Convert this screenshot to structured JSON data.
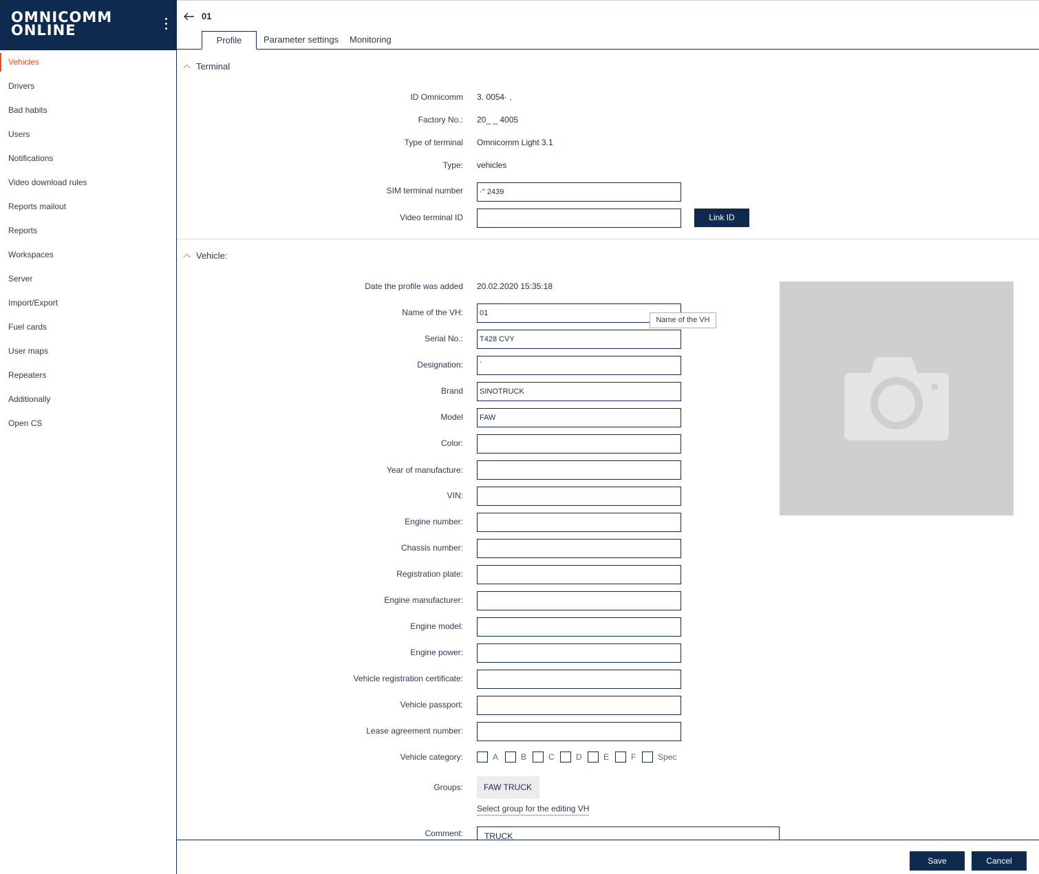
{
  "app": {
    "logo_line1": "OMNICOMM",
    "logo_line2": "ONLINE"
  },
  "sidebar": {
    "items": [
      {
        "label": "Vehicles",
        "active": true
      },
      {
        "label": "Drivers"
      },
      {
        "label": "Bad habits"
      },
      {
        "label": "Users"
      },
      {
        "label": "Notifications"
      },
      {
        "label": "Video download rules"
      },
      {
        "label": "Reports mailout"
      },
      {
        "label": "Reports"
      },
      {
        "label": "Workspaces"
      },
      {
        "label": "Server"
      },
      {
        "label": "Import/Export"
      },
      {
        "label": "Fuel cards"
      },
      {
        "label": "User maps"
      },
      {
        "label": "Repeaters"
      },
      {
        "label": "Additionally"
      },
      {
        "label": "Open CS"
      }
    ]
  },
  "header": {
    "title": "01",
    "tabs": [
      "Profile",
      "Parameter settings",
      "Monitoring"
    ]
  },
  "terminal": {
    "section_title": "Terminal",
    "id_label": "ID Omnicomm",
    "id_value": "3.  0054·  ,",
    "factory_label": "Factory No.:",
    "factory_value": "20_ _ 4005",
    "type_terminal_label": "Type of terminal",
    "type_terminal_value": "Omnicomm Light 3.1",
    "type_label": "Type:",
    "type_value": "vehicles",
    "sim_label": "SIM terminal number",
    "sim_value": "  ·'' 2439",
    "video_label": "Video terminal ID",
    "video_value": "",
    "link_button": "Link ID"
  },
  "vehicle": {
    "section_title": "Vehicle:",
    "date_label": "Date the profile was added",
    "date_value": "20.02.2020 15:35:18",
    "name_tooltip": "Name of the VH",
    "fields": [
      {
        "label": "Name of the VH:",
        "value": "01"
      },
      {
        "label": "Serial No.:",
        "value": "T428 CVY"
      },
      {
        "label": "Designation:",
        "value": "                  `"
      },
      {
        "label": "Brand",
        "value": "SINOTRUCK"
      },
      {
        "label": "Model",
        "value": "FAW"
      },
      {
        "label": "Color:",
        "value": ""
      },
      {
        "label": "Year of manufacture:",
        "value": ""
      },
      {
        "label": "VIN:",
        "value": ""
      },
      {
        "label": "Engine number:",
        "value": ""
      },
      {
        "label": "Chassis number:",
        "value": ""
      },
      {
        "label": "Registration plate:",
        "value": ""
      },
      {
        "label": "Engine manufacturer:",
        "value": ""
      },
      {
        "label": "Engine model:",
        "value": ""
      },
      {
        "label": "Engine power:",
        "value": ""
      },
      {
        "label": "Vehicle registration certificate:",
        "value": ""
      },
      {
        "label": "Vehicle passport:",
        "value": ""
      },
      {
        "label": "Lease agreement number:",
        "value": ""
      }
    ],
    "category_label": "Vehicle category:",
    "categories": [
      "A",
      "B",
      "C",
      "D",
      "E",
      "F",
      "Spec"
    ],
    "groups_label": "Groups:",
    "group_chip": "FAW TRUCK",
    "group_link": "Select group for the editing VH",
    "comment_label": "Comment:",
    "comment_value": "TRUCK"
  },
  "footer": {
    "save": "Save",
    "cancel": "Cancel"
  },
  "colors": {
    "brand_navy": "#0f2a4f",
    "active_accent": "#e8501e",
    "photo_placeholder": "#cfcfcf"
  }
}
